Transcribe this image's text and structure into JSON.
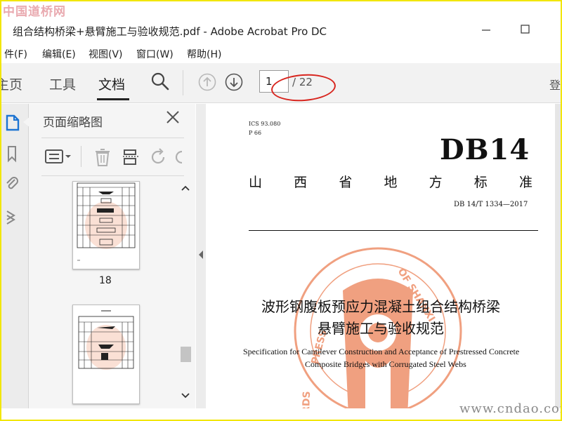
{
  "watermark": {
    "top": "中国道桥网",
    "bottom": "www.cndao.com"
  },
  "window": {
    "title": "组合结构桥梁+悬臂施工与验收规范.pdf - Adobe Acrobat Pro DC"
  },
  "menu": {
    "items": [
      "件(F)",
      "编辑(E)",
      "视图(V)",
      "窗口(W)",
      "帮助(H)"
    ]
  },
  "toolbar": {
    "tabs": [
      "主页",
      "工具",
      "文档"
    ],
    "active_tab": "文档",
    "page_current": "1",
    "page_total": "/ 22",
    "right_cut_text": "登"
  },
  "panel": {
    "title": "页面缩略图",
    "thumbnails": [
      {
        "label": "18"
      }
    ]
  },
  "document": {
    "ics": "ICS 93.080",
    "p": "P 66",
    "code": "DB14",
    "province_chars": [
      "山",
      "西",
      "省",
      "地",
      "方",
      "标",
      "准"
    ],
    "standard_no": "DB 14/T 1334—2017",
    "title_cn_line1": "波形钢腹板预应力混凝土组合结构桥梁",
    "title_cn_line2": "悬臂施工与验收规范",
    "title_en_line1": "Specification for Cantilever Construction and Acceptance of   Prestressed Concrete",
    "title_en_line2": "Composite Bridges with Corrugated Steel Webs",
    "seal_text_upper": "OF SHANXI",
    "seal_text_left": "PRESS",
    "seal_text_lower": "RDS"
  },
  "colors": {
    "accent_oval": "#d8261f",
    "seal": "#f0a080",
    "frame": "#f2e600"
  }
}
